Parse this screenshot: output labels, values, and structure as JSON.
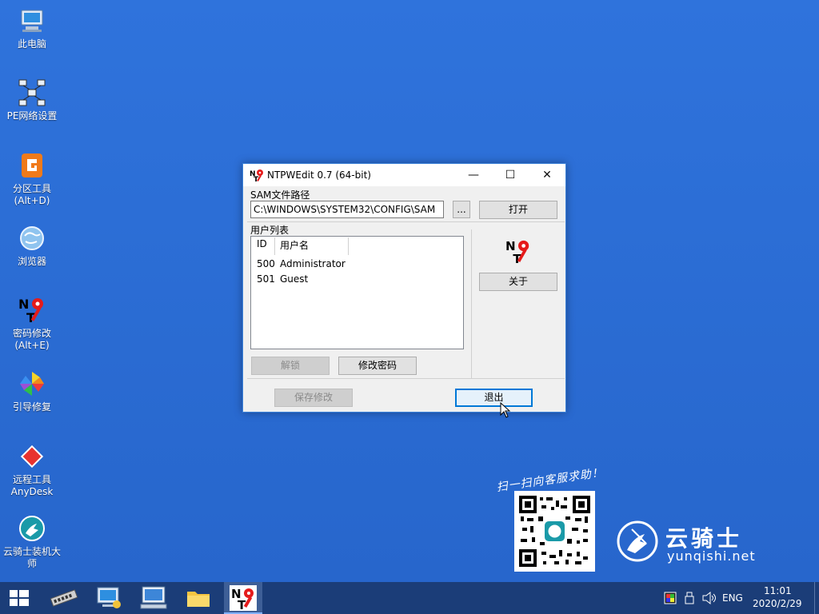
{
  "desktop_icons": [
    {
      "label": "此电脑",
      "icon": "computer-icon"
    },
    {
      "label": "PE网络设置",
      "icon": "network-icon"
    },
    {
      "label": "分区工具\n(Alt+D)",
      "icon": "diskgenius-icon"
    },
    {
      "label": "浏览器",
      "icon": "browser-icon"
    },
    {
      "label": "密码修改\n(Alt+E)",
      "icon": "ntpwedit-icon"
    },
    {
      "label": "引导修复",
      "icon": "pinwheel-icon"
    },
    {
      "label": "远程工具\nAnyDesk",
      "icon": "anydesk-icon"
    },
    {
      "label": "云骑士装机大\n师",
      "icon": "yunqishi-icon"
    }
  ],
  "window": {
    "title": "NTPWEdit 0.7 (64-bit)",
    "minimize": "—",
    "maximize": "☐",
    "close": "✕",
    "sam_group_label": "SAM文件路径",
    "sam_path": "C:\\WINDOWS\\SYSTEM32\\CONFIG\\SAM",
    "browse_label": "...",
    "open_label": "打开",
    "users_group_label": "用户列表",
    "columns": [
      "ID",
      "用户名"
    ],
    "users": [
      {
        "id": "500",
        "name": "Administrator"
      },
      {
        "id": "501",
        "name": "Guest"
      }
    ],
    "unlock_label": "解锁",
    "change_password_label": "修改密码",
    "about_label": "关于",
    "save_label": "保存修改",
    "exit_label": "退出"
  },
  "promo": {
    "scan_text": "扫一扫向客服求助！",
    "brand_name": "云骑士",
    "brand_url": "yunqishi.net"
  },
  "taskbar": {
    "language": "ENG",
    "time": "11:01",
    "date": "2020/2/29"
  },
  "colors": {
    "desktop": "#2d6fd6",
    "taskbar": "#1b3d78",
    "accent": "#0078d7"
  }
}
